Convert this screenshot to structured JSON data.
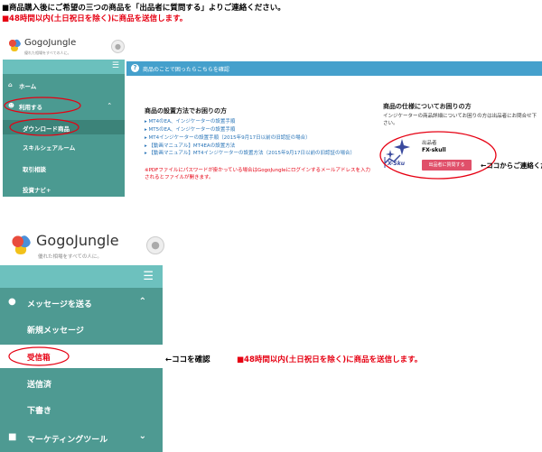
{
  "instructions": {
    "line1": "■商品購入後にご希望の三つの商品を「出品者に質問する」よりご連絡ください。",
    "line2": "■48時間以内(土日祝日を除く)に商品を送信します。"
  },
  "shot1": {
    "logo": "GogoJungle",
    "tagline": "優れた相場をすべての人に。",
    "menu_items": [
      "ホーム",
      "利用する",
      "ダウンロード商品",
      "スキルシェアルーム",
      "取引相談",
      "投資ナビ+"
    ],
    "banner": "商品のことで困ったらこちらを確認",
    "setup_title": "商品の設置方法でお困りの方",
    "setup_links": [
      "MT4のEA、インジケーターの設置手順",
      "MT5のEA、インジケーターの設置手順",
      "MT4インジケーターの設置手順（2015年9月17日以前の旧認証の場合）",
      "【動画マニュアル】MT4EAの設置方法",
      "【動画マニュアル】MT4インジケーターの設置方法（2015年9月17日以前の旧認証の場合）"
    ],
    "setup_note": "※PDFファイルにパスワードが掛かっている場合はGogoJungleにログインするメールアドレスを入力されるとファイルが開きます。",
    "spec_title": "商品の仕様についてお困りの方",
    "spec_desc": "インジケーターの商品詳細についてお困りの方は出品者にお問合せ下さい。",
    "seller_label": "出品者",
    "seller_name": "FX-skull",
    "seller_logo_text": "X-Sku",
    "ask_button": "出品者に質問する",
    "callout": "←ココからご連絡ください"
  },
  "shot2": {
    "logo": "GogoJungle",
    "tagline": "優れた相場をすべての人に。",
    "section": "メッセージを送る",
    "items": [
      "新規メッセージ",
      "受信箱",
      "送信済",
      "下書き"
    ],
    "marketing": "マーケティングツール",
    "callout_black": "←ココを確認",
    "callout_red": "■48時間以内(土日祝日を除く)に商品を送信します。"
  },
  "colors": {
    "sidebar": "#4b9a91",
    "topbar": "#6bc0bd",
    "banner": "#45a0cc",
    "accent_red": "#e60012",
    "button": "#e0506a"
  }
}
